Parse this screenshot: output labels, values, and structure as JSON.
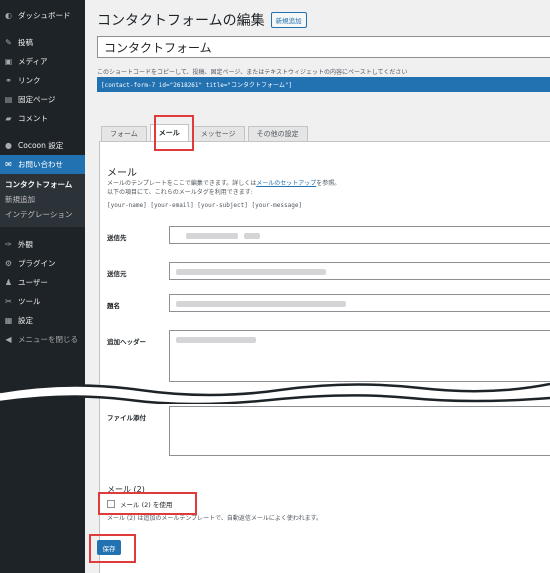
{
  "sidebar": {
    "items": [
      {
        "label": "ダッシュボード",
        "icon": "dashboard-icon",
        "glyph": "◐"
      },
      {
        "label": "投稿",
        "icon": "pin-icon",
        "glyph": "✎"
      },
      {
        "label": "メディア",
        "icon": "media-icon",
        "glyph": "▣"
      },
      {
        "label": "リンク",
        "icon": "link-icon",
        "glyph": "⚭"
      },
      {
        "label": "固定ページ",
        "icon": "page-icon",
        "glyph": "▤"
      },
      {
        "label": "コメント",
        "icon": "comment-icon",
        "glyph": "▰"
      },
      {
        "label": "Cocoon 設定",
        "icon": "cocoon-icon",
        "glyph": "●"
      },
      {
        "label": "お問い合わせ",
        "icon": "mail-icon",
        "glyph": "✉"
      },
      {
        "label": "外観",
        "icon": "appearance-icon",
        "glyph": "✑"
      },
      {
        "label": "プラグイン",
        "icon": "plugin-icon",
        "glyph": "⚙"
      },
      {
        "label": "ユーザー",
        "icon": "user-icon",
        "glyph": "♟"
      },
      {
        "label": "ツール",
        "icon": "tool-icon",
        "glyph": "✂"
      },
      {
        "label": "設定",
        "icon": "settings-icon",
        "glyph": "▦"
      },
      {
        "label": "メニューを閉じる",
        "icon": "collapse-icon",
        "glyph": "◀"
      }
    ],
    "submenu": [
      "コンタクトフォーム",
      "新規追加",
      "インテグレーション"
    ]
  },
  "header": {
    "title": "コンタクトフォームの編集",
    "new_button": "新規追加"
  },
  "form_title": "コンタクトフォーム",
  "shortcode": {
    "description": "このショートコードをコピーして、投稿、固定ページ、またはテキストウィジェットの内容にペーストしてください",
    "code": "[contact-form-7 id=\"2618261\" title=\"コンタクトフォーム\"]"
  },
  "tabs": [
    "フォーム",
    "メール",
    "メッセージ",
    "その他の設定"
  ],
  "mail": {
    "title": "メール",
    "desc_1": "メールのテンプレートをここで編集できます。詳しくは",
    "desc_link": "メールのセットアップ",
    "desc_2": "を参照。",
    "desc_line2": "以下の項目にて、これらのメールタグを利用できます:",
    "tags": "[your-name] [your-email] [your-subject] [your-message]",
    "fields": {
      "to": "送信先",
      "from": "送信元",
      "subject": "題名",
      "headers": "追加ヘッダー",
      "attachments": "ファイル添付"
    }
  },
  "mail2": {
    "title": "メール (2)",
    "checkbox_label": "メール (2) を使用",
    "description": "メール (2) は追加のメールテンプレートで、自動返信メールによく使われます。"
  },
  "save_button": "保存",
  "colors": {
    "accent": "#2271b1",
    "sidebar": "#1d2327",
    "highlight": "#e03b3b"
  }
}
